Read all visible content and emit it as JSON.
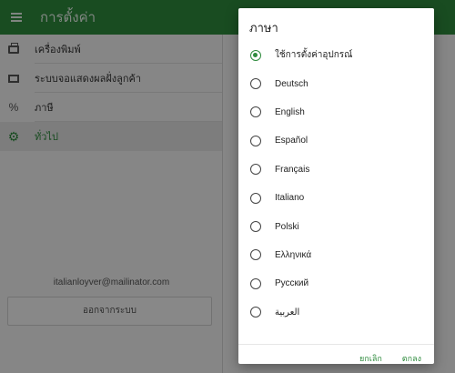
{
  "app": {
    "title": "การตั้งค่า"
  },
  "sidebar": {
    "items": [
      {
        "label": "เครื่องพิมพ์",
        "icon": "printer-icon"
      },
      {
        "label": "ระบบจอแสดงผลฝั่งลูกค้า",
        "icon": "monitor-icon"
      },
      {
        "label": "ภาษี",
        "icon": "percent-icon"
      },
      {
        "label": "ทั่วไป",
        "icon": "gear-icon",
        "active": true
      }
    ],
    "email": "italianloyver@mailinator.com",
    "logout_label": "ออกจากระบบ"
  },
  "dialog": {
    "title": "ภาษา",
    "options": [
      {
        "label": "ใช้การตั้งค่าอุปกรณ์",
        "selected": true
      },
      {
        "label": "Deutsch"
      },
      {
        "label": "English"
      },
      {
        "label": "Español"
      },
      {
        "label": "Français"
      },
      {
        "label": "Italiano"
      },
      {
        "label": "Polski"
      },
      {
        "label": "Ελληνικά"
      },
      {
        "label": "Русский"
      },
      {
        "label": "العربية"
      }
    ],
    "cancel_label": "ยกเลิก",
    "ok_label": "ตกลง"
  },
  "colors": {
    "accent": "#2e8b3d"
  }
}
